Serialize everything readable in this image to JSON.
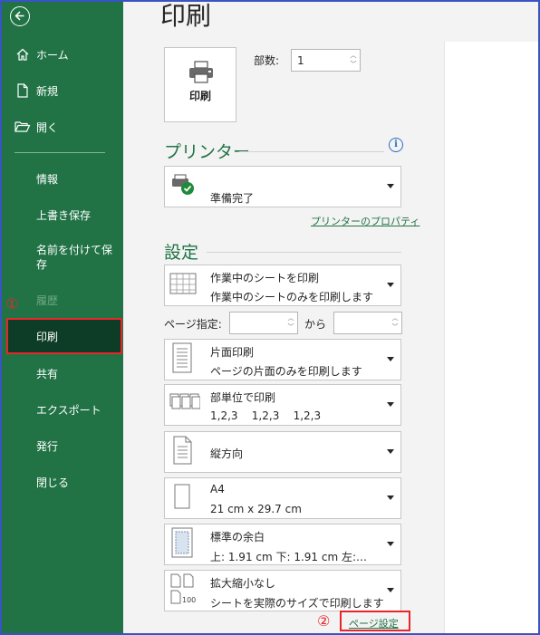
{
  "sidebar": {
    "items": [
      {
        "label": "ホーム",
        "icon": "home-icon"
      },
      {
        "label": "新規",
        "icon": "new-document-icon"
      },
      {
        "label": "開く",
        "icon": "open-folder-icon"
      },
      {
        "label": "情報"
      },
      {
        "label": "上書き保存"
      },
      {
        "label": "名前を付けて保存"
      },
      {
        "label": "履歴"
      },
      {
        "label": "印刷"
      },
      {
        "label": "共有"
      },
      {
        "label": "エクスポート"
      },
      {
        "label": "発行"
      },
      {
        "label": "閉じる"
      }
    ],
    "marker_1": "①"
  },
  "main": {
    "title": "印刷",
    "print_button_label": "印刷",
    "copies_label": "部数:",
    "copies_value": "1",
    "printer_heading": "プリンター",
    "printer_status": "準備完了",
    "printer_properties_link": "プリンターのプロパティ",
    "settings_heading": "設定",
    "settings": [
      {
        "title": "作業中のシートを印刷",
        "sub": "作業中のシートのみを印刷します",
        "icon": "sheet-grid-icon"
      },
      {
        "title": "片面印刷",
        "sub": "ページの片面のみを印刷します",
        "icon": "one-sided-icon"
      },
      {
        "title": "部単位で印刷",
        "sub": "1,2,3    1,2,3    1,2,3",
        "icon": "collate-icon"
      },
      {
        "title": "縦方向",
        "sub": "",
        "icon": "portrait-icon"
      },
      {
        "title": "A4",
        "sub": "21 cm x 29.7 cm",
        "icon": "paper-size-icon"
      },
      {
        "title": "標準の余白",
        "sub": "上: 1.91 cm 下: 1.91 cm 左:…",
        "icon": "margins-icon"
      },
      {
        "title": "拡大縮小なし",
        "sub": "シートを実際のサイズで印刷します",
        "icon": "scaling-icon"
      }
    ],
    "pages_label": "ページ指定:",
    "pages_from": "",
    "pages_to_label": "から",
    "pages_to": "",
    "page_setup_link": "ページ設定",
    "marker_2": "②"
  },
  "colors": {
    "accent": "#217346",
    "sidebar_selected": "#0d3d26",
    "highlight": "#e8262a"
  }
}
